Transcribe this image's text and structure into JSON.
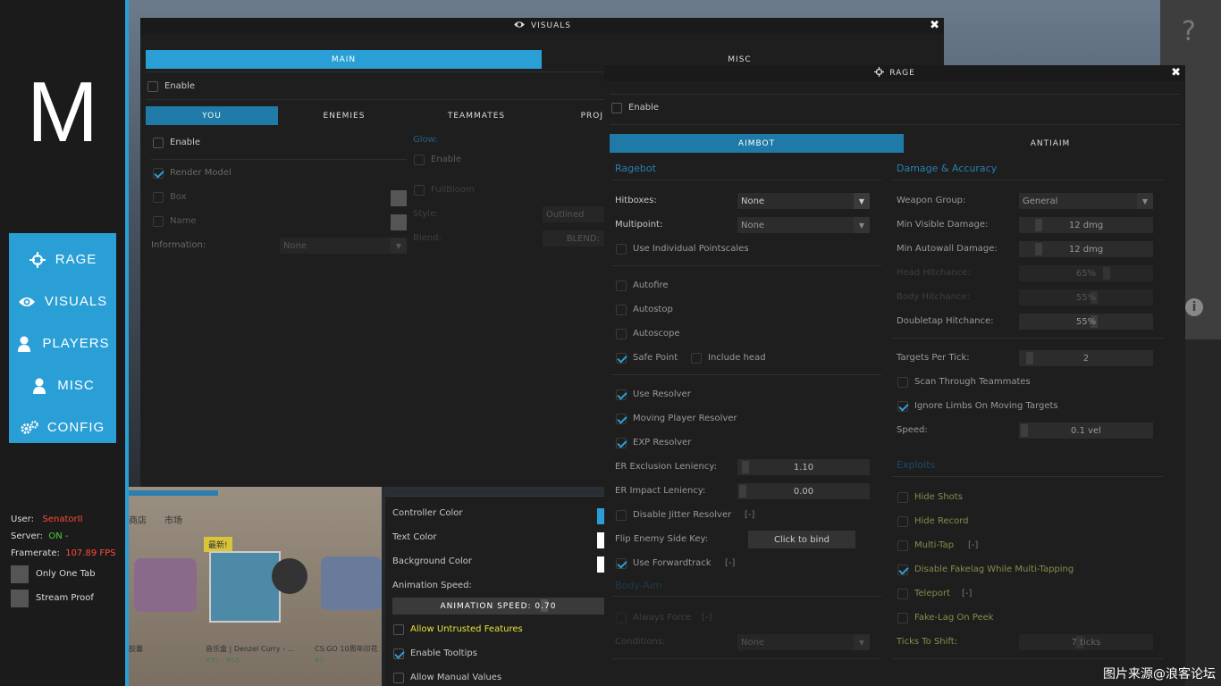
{
  "sidebar": {
    "logo": "M",
    "nav": [
      {
        "label": "RAGE",
        "icon": "crosshair-icon"
      },
      {
        "label": "VISUALS",
        "icon": "eye-icon"
      },
      {
        "label": "PLAYERS",
        "icon": "user-icon"
      },
      {
        "label": "MISC",
        "icon": "user-icon"
      },
      {
        "label": "CONFIG",
        "icon": "gears-icon"
      }
    ],
    "info": {
      "user_label": "User:",
      "user_value": "SenatorII",
      "server_label": "Server:",
      "server_value": "ON -",
      "framerate_label": "Framerate:",
      "framerate_value": "107.89 FPS",
      "only_one_tab": "Only One Tab",
      "stream_proof": "Stream Proof"
    }
  },
  "visuals": {
    "title": "VISUALS",
    "tabs": [
      "MAIN",
      "MISC"
    ],
    "enable": "Enable",
    "subtabs": [
      "YOU",
      "ENEMIES",
      "TEAMMATES",
      "PROJ"
    ],
    "you": {
      "enable": "Enable",
      "render_model": "Render Model",
      "box": "Box",
      "name": "Name",
      "information_label": "Information:",
      "information_value": "None",
      "glow_label": "Glow:",
      "glow_enable": "Enable",
      "fullbloom": "FullBloom",
      "style_label": "Style:",
      "style_value": "Outlined",
      "blend_label": "Blend:",
      "blend_value": "BLEND:"
    },
    "misc_panel": {
      "controller_color": "Controller Color",
      "text_color": "Text Color",
      "background_color": "Background Color",
      "animation_speed_label": "Animation Speed:",
      "animation_speed_value": "ANIMATION SPEED: 0.70",
      "allow_untrusted": "Allow Untrusted Features",
      "enable_tooltips": "Enable Tooltips",
      "allow_manual": "Allow Manual Values",
      "controller_hex": "#2a9fd6",
      "text_hex": "#ffffff",
      "background_hex": "#ffffff"
    }
  },
  "store": {
    "tabs": [
      "商店",
      "市场"
    ],
    "badge": "最新!",
    "item1": "音乐盒 | Denzel Curry - ...",
    "item1_price": "¥35 - ¥55",
    "item2": "CS:GO 10周年印花",
    "item2_price": "¥7",
    "item0": "胶囊"
  },
  "rage": {
    "title": "RAGE",
    "enable": "Enable",
    "tabs": [
      "AIMBOT",
      "ANTIAIM"
    ],
    "ragebot_header": "Ragebot",
    "hitboxes_label": "Hitboxes:",
    "hitboxes_value": "None",
    "multipoint_label": "Multipoint:",
    "multipoint_value": "None",
    "individual_pointscales": "Use Individual Pointscales",
    "autofire": "Autofire",
    "autostop": "Autostop",
    "autoscope": "Autoscope",
    "safe_point": "Safe Point",
    "include_head": "Include head",
    "use_resolver": "Use Resolver",
    "moving_player_resolver": "Moving Player Resolver",
    "exp_resolver": "EXP Resolver",
    "er_exclusion_label": "ER Exclusion Leniency:",
    "er_exclusion_value": "1.10",
    "er_impact_label": "ER Impact Leniency:",
    "er_impact_value": "0.00",
    "disable_jitter": "Disable Jitter Resolver",
    "bracket": "[-]",
    "flip_key_label": "Flip Enemy Side Key:",
    "flip_key_value": "Click to bind",
    "use_forwardtrack": "Use Forwardtrack",
    "body_aim_header": "Body-Aim",
    "always_force": "Always Force",
    "conditions_label": "Conditions:",
    "conditions_value": "None",
    "damage_header": "Damage & Accuracy",
    "weapon_group_label": "Weapon Group:",
    "weapon_group_value": "General",
    "min_visible_label": "Min Visible Damage:",
    "min_visible_value": "12 dmg",
    "min_autowall_label": "Min Autowall Damage:",
    "min_autowall_value": "12 dmg",
    "head_hitchance_label": "Head Hitchance:",
    "head_hitchance_value": "65%",
    "body_hitchance_label": "Body Hitchance:",
    "body_hitchance_value": "55%",
    "doubletap_hitchance_label": "Doubletap Hitchance:",
    "doubletap_hitchance_value": "55%",
    "targets_per_tick_label": "Targets Per Tick:",
    "targets_per_tick_value": "2",
    "scan_teammates": "Scan Through Teammates",
    "ignore_limbs": "Ignore Limbs On Moving Targets",
    "speed_label": "Speed:",
    "speed_value": "0.1 vel",
    "exploits_header": "Exploits",
    "hide_shots": "Hide Shots",
    "hide_record": "Hide Record",
    "multi_tap": "Multi-Tap",
    "disable_fakelag": "Disable Fakelag While Multi-Tapping",
    "teleport": "Teleport",
    "fakelag_on_peek": "Fake-Lag On Peek",
    "ticks_to_shift_label": "Ticks To Shift:",
    "ticks_to_shift_value": "7 ticks"
  },
  "watermark": "图片来源@浪客论坛",
  "help_icon": "?"
}
